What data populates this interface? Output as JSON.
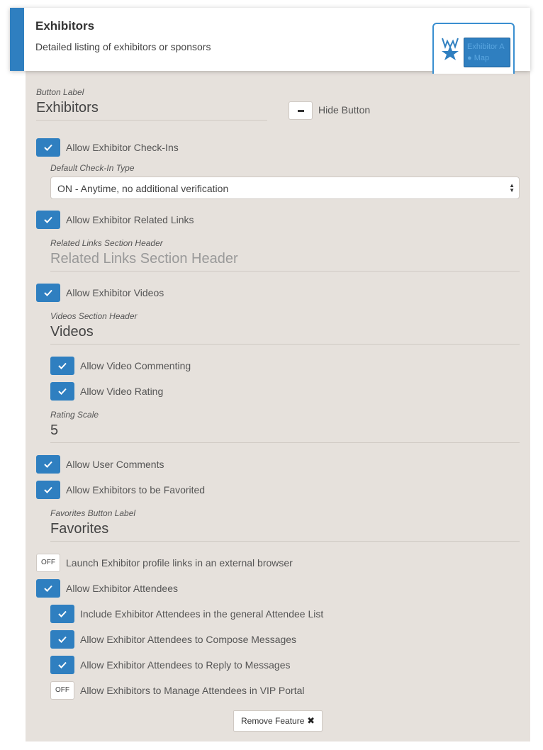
{
  "header": {
    "title": "Exhibitors",
    "description": "Detailed listing of exhibitors or sponsors",
    "preview": {
      "line1": "Exhibitor A",
      "line2": "Map"
    }
  },
  "button_label": {
    "label": "Button Label",
    "value": "Exhibitors",
    "hide_label": "Hide Button"
  },
  "checkins": {
    "label": "Allow Exhibitor Check-Ins",
    "checked": true,
    "type_label": "Default Check-In Type",
    "type_value": "ON - Anytime, no additional verification"
  },
  "related_links": {
    "label": "Allow Exhibitor Related Links",
    "checked": true,
    "header_label": "Related Links Section Header",
    "header_placeholder": "Related Links Section Header"
  },
  "videos": {
    "label": "Allow Exhibitor Videos",
    "checked": true,
    "header_label": "Videos Section Header",
    "header_value": "Videos",
    "commenting_label": "Allow Video Commenting",
    "rating_label": "Allow Video Rating",
    "scale_label": "Rating Scale",
    "scale_value": "5"
  },
  "user_comments": {
    "label": "Allow User Comments",
    "checked": true
  },
  "favorites": {
    "label": "Allow Exhibitors to be Favorited",
    "checked": true,
    "button_label_label": "Favorites Button Label",
    "button_label_value": "Favorites"
  },
  "external_browser": {
    "toggle": "OFF",
    "label": "Launch Exhibitor profile links in an external browser"
  },
  "attendees": {
    "label": "Allow Exhibitor Attendees",
    "checked": true,
    "include_label": "Include Exhibitor Attendees in the general Attendee List",
    "compose_label": "Allow Exhibitor Attendees to Compose Messages",
    "reply_label": "Allow Exhibitor Attendees to Reply to Messages",
    "vip_toggle": "OFF",
    "vip_label": "Allow Exhibitors to Manage Attendees in VIP Portal"
  },
  "remove_button": "Remove Feature",
  "colors": {
    "accent": "#2f7fc0",
    "panel": "#e6e1dc"
  }
}
